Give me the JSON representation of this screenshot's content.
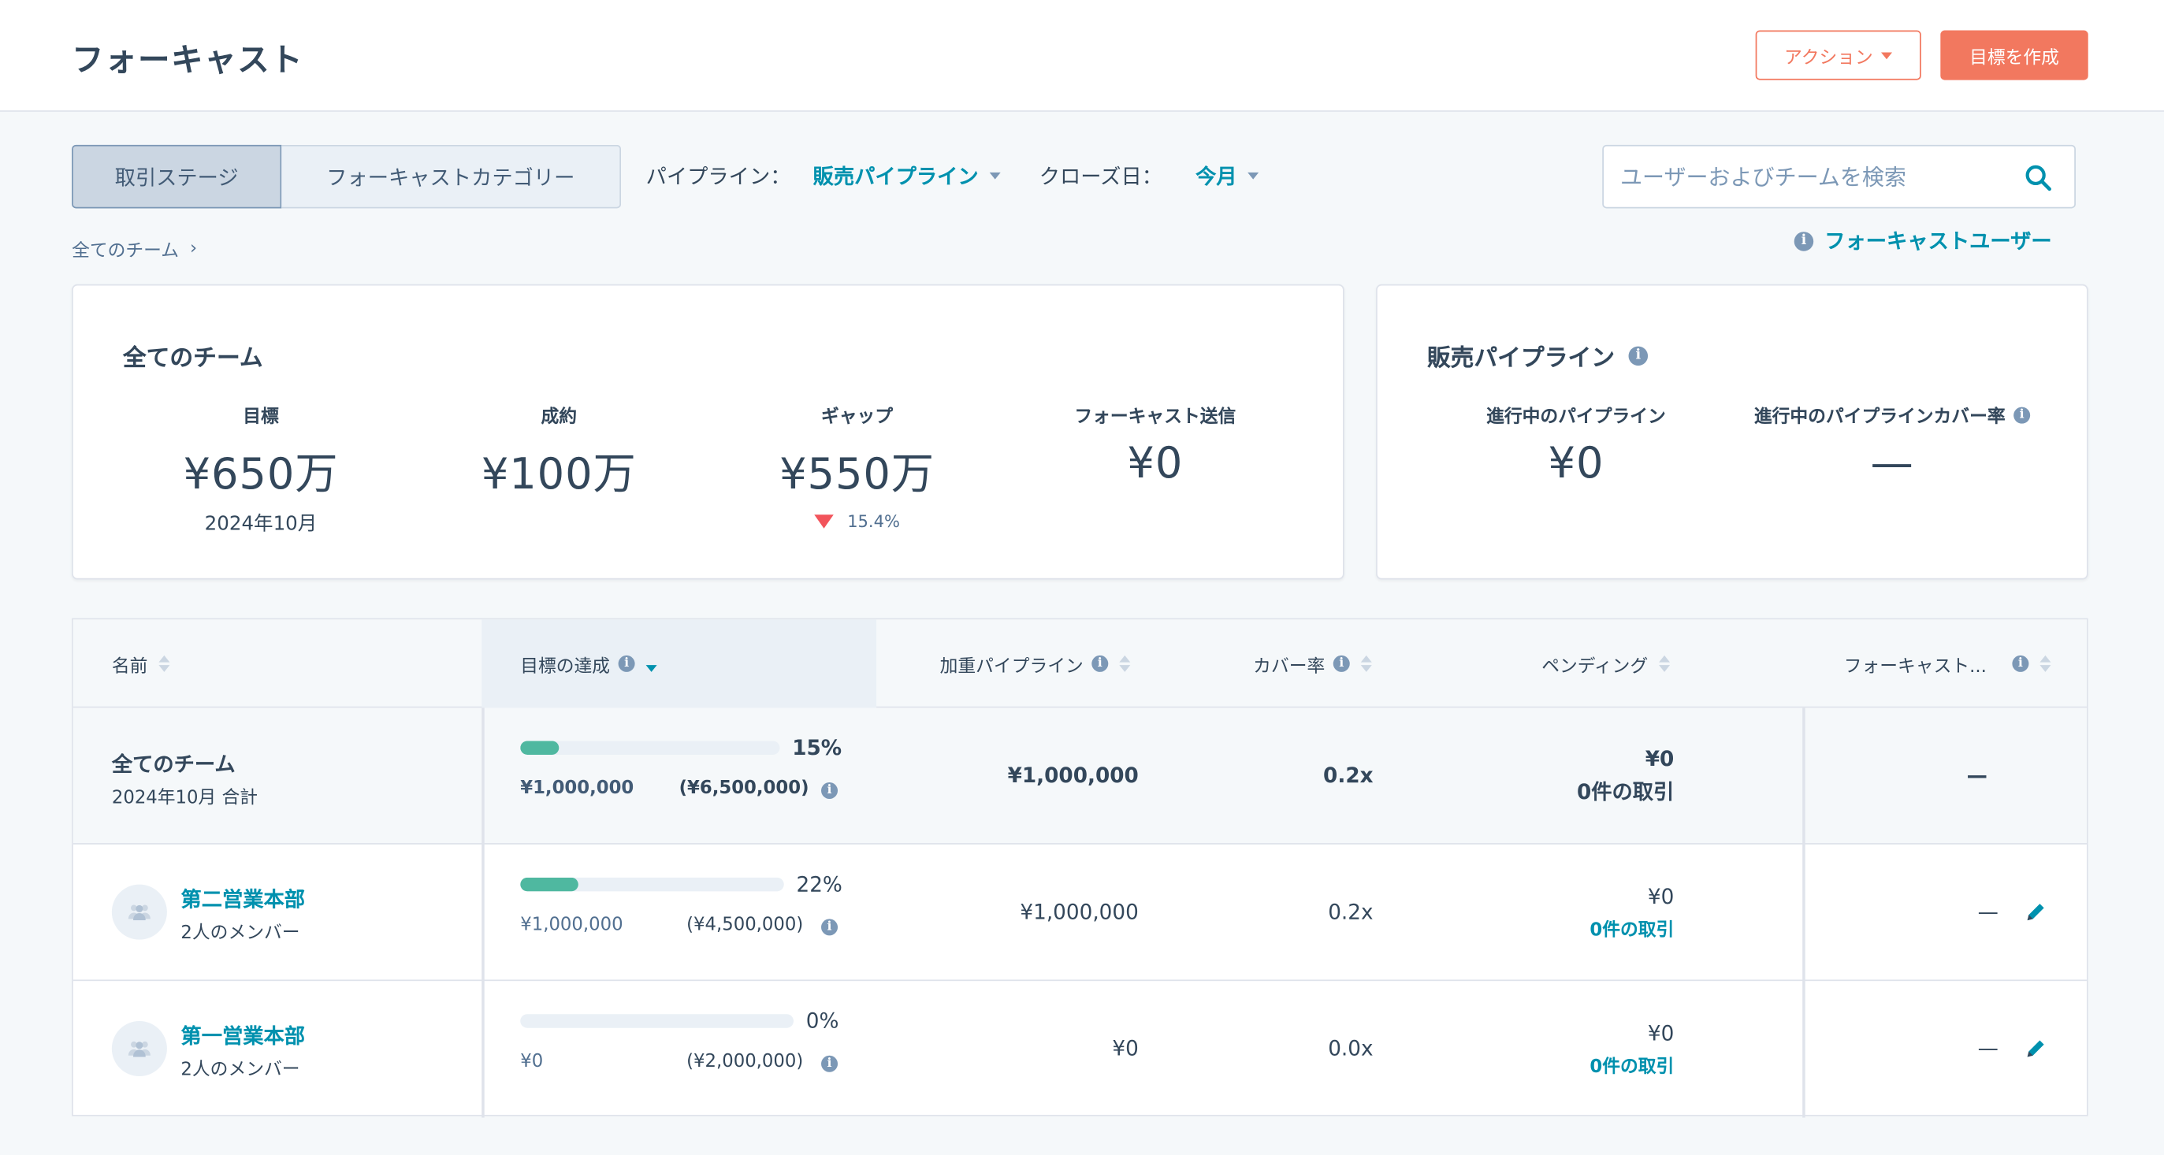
{
  "header": {
    "title": "フォーキャスト",
    "action_label": "アクション",
    "create_goal_label": "目標を作成"
  },
  "colors": {
    "accent": "#f2785f",
    "link": "#0091ae",
    "progress": "#4fb8a0",
    "negative": "#f2545b"
  },
  "filters": {
    "tabs": [
      {
        "label": "取引ステージ",
        "active": true
      },
      {
        "label": "フォーキャストカテゴリー",
        "active": false
      }
    ],
    "pipeline_label": "パイプライン：",
    "pipeline_value": "販売パイプライン",
    "close_date_label": "クローズ日：",
    "close_date_value": "今月",
    "search_placeholder": "ユーザーおよびチームを検索"
  },
  "breadcrumb": {
    "label": "全てのチーム",
    "chevron": "›"
  },
  "forecast_users_label": "フォーキャストユーザー",
  "summary_card": {
    "title": "全てのチーム",
    "metrics": {
      "goal": {
        "label": "目標",
        "value": "¥650万",
        "sub": "2024年10月"
      },
      "won": {
        "label": "成約",
        "value": "¥100万"
      },
      "gap": {
        "label": "ギャップ",
        "value": "¥550万",
        "delta": "15.4%"
      },
      "submission": {
        "label": "フォーキャスト送信",
        "value": "¥0"
      }
    }
  },
  "pipeline_card": {
    "title": "販売パイプライン",
    "metrics": {
      "open": {
        "label": "進行中のパイプライン",
        "value": "¥0"
      },
      "coverage": {
        "label": "進行中のパイプラインカバー率",
        "value": "—"
      }
    }
  },
  "table": {
    "columns": [
      "名前",
      "目標の達成",
      "加重パイプライン",
      "カバー率",
      "ペンディング",
      "フォーキャスト..."
    ],
    "rows": [
      {
        "name": "全てのチーム",
        "sub": "2024年10月 合計",
        "progress": 0.15,
        "pct": "15%",
        "achieved": "¥1,000,000",
        "goal": "(¥6,500,000)",
        "weighted": "¥1,000,000",
        "coverage": "0.2x",
        "pending": "¥0",
        "deals": "0件の取引",
        "forecast": "—"
      },
      {
        "name": "第二営業本部",
        "sub": "2人のメンバー",
        "progress": 0.22,
        "pct": "22%",
        "achieved": "¥1,000,000",
        "goal": "(¥4,500,000)",
        "weighted": "¥1,000,000",
        "coverage": "0.2x",
        "pending": "¥0",
        "deals": "0件の取引",
        "forecast": "—"
      },
      {
        "name": "第一営業本部",
        "sub": "2人のメンバー",
        "progress": 0.0,
        "pct": "0%",
        "achieved": "¥0",
        "goal": "(¥2,000,000)",
        "weighted": "¥0",
        "coverage": "0.0x",
        "pending": "¥0",
        "deals": "0件の取引",
        "forecast": "—"
      }
    ]
  }
}
